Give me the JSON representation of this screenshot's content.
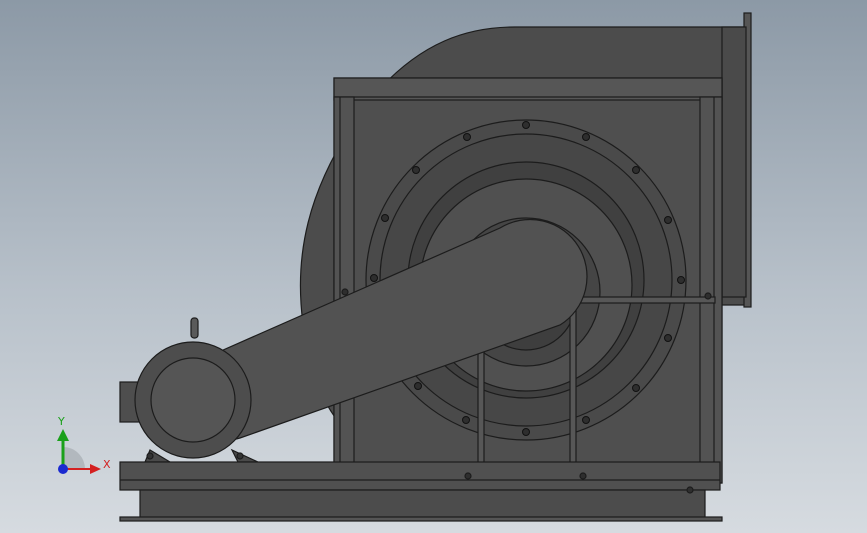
{
  "triad": {
    "x_label": "X",
    "y_label": "Y",
    "colors": {
      "x": "#d42020",
      "y": "#1aa01a",
      "z": "#1a2ad0"
    }
  },
  "model": {
    "icon": "centrifugal-fan-with-motor",
    "body_color": "#4a4a4a",
    "edge_color": "#1c1c1c",
    "bolt_holes": 16
  }
}
